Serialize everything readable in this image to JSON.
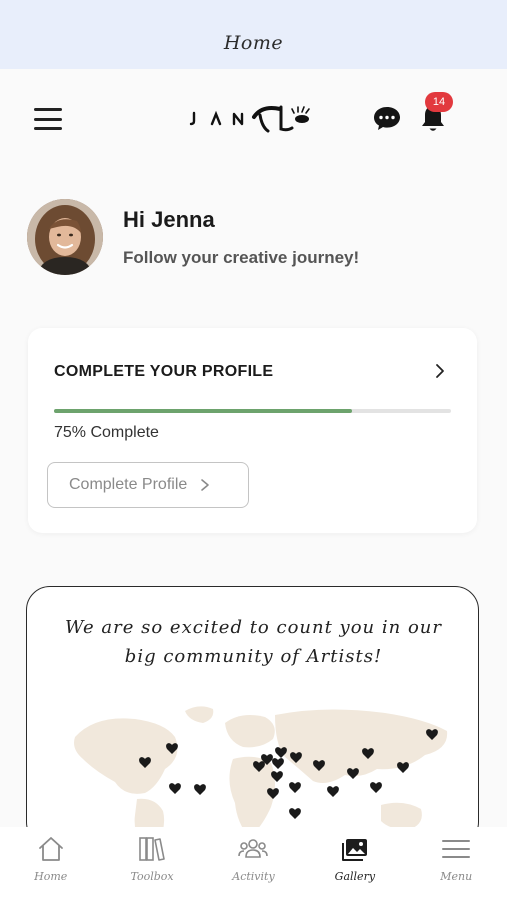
{
  "status_bar": {
    "title": "Home"
  },
  "header": {
    "logo_alt": "JANE",
    "notification_count": "14",
    "icons": {
      "menu": "hamburger-menu-icon",
      "chat": "chat-bubble-icon",
      "bell": "bell-icon"
    }
  },
  "greeting": {
    "title": "Hi Jenna",
    "subtitle": "Follow your creative journey!"
  },
  "profile_card": {
    "title": "COMPLETE YOUR PROFILE",
    "progress": 0.75,
    "progress_text": "75% Complete",
    "button_label": "Complete Profile",
    "colors": {
      "progress": "#6da36d",
      "track": "#e3e3e3"
    }
  },
  "community": {
    "line1": "We are so excited to count you in our",
    "line2": "big community of Artists!"
  },
  "bottom_nav": {
    "items": [
      {
        "label": "Home",
        "icon": "home-icon"
      },
      {
        "label": "Toolbox",
        "icon": "books-icon"
      },
      {
        "label": "Activity",
        "icon": "people-icon"
      },
      {
        "label": "Gallery",
        "icon": "gallery-icon",
        "active": true
      },
      {
        "label": "Menu",
        "icon": "menu-icon"
      }
    ]
  },
  "colors": {
    "status_bar_bg": "#e8eefb",
    "badge": "#e2393e",
    "text_dark": "#1b1b1b"
  }
}
